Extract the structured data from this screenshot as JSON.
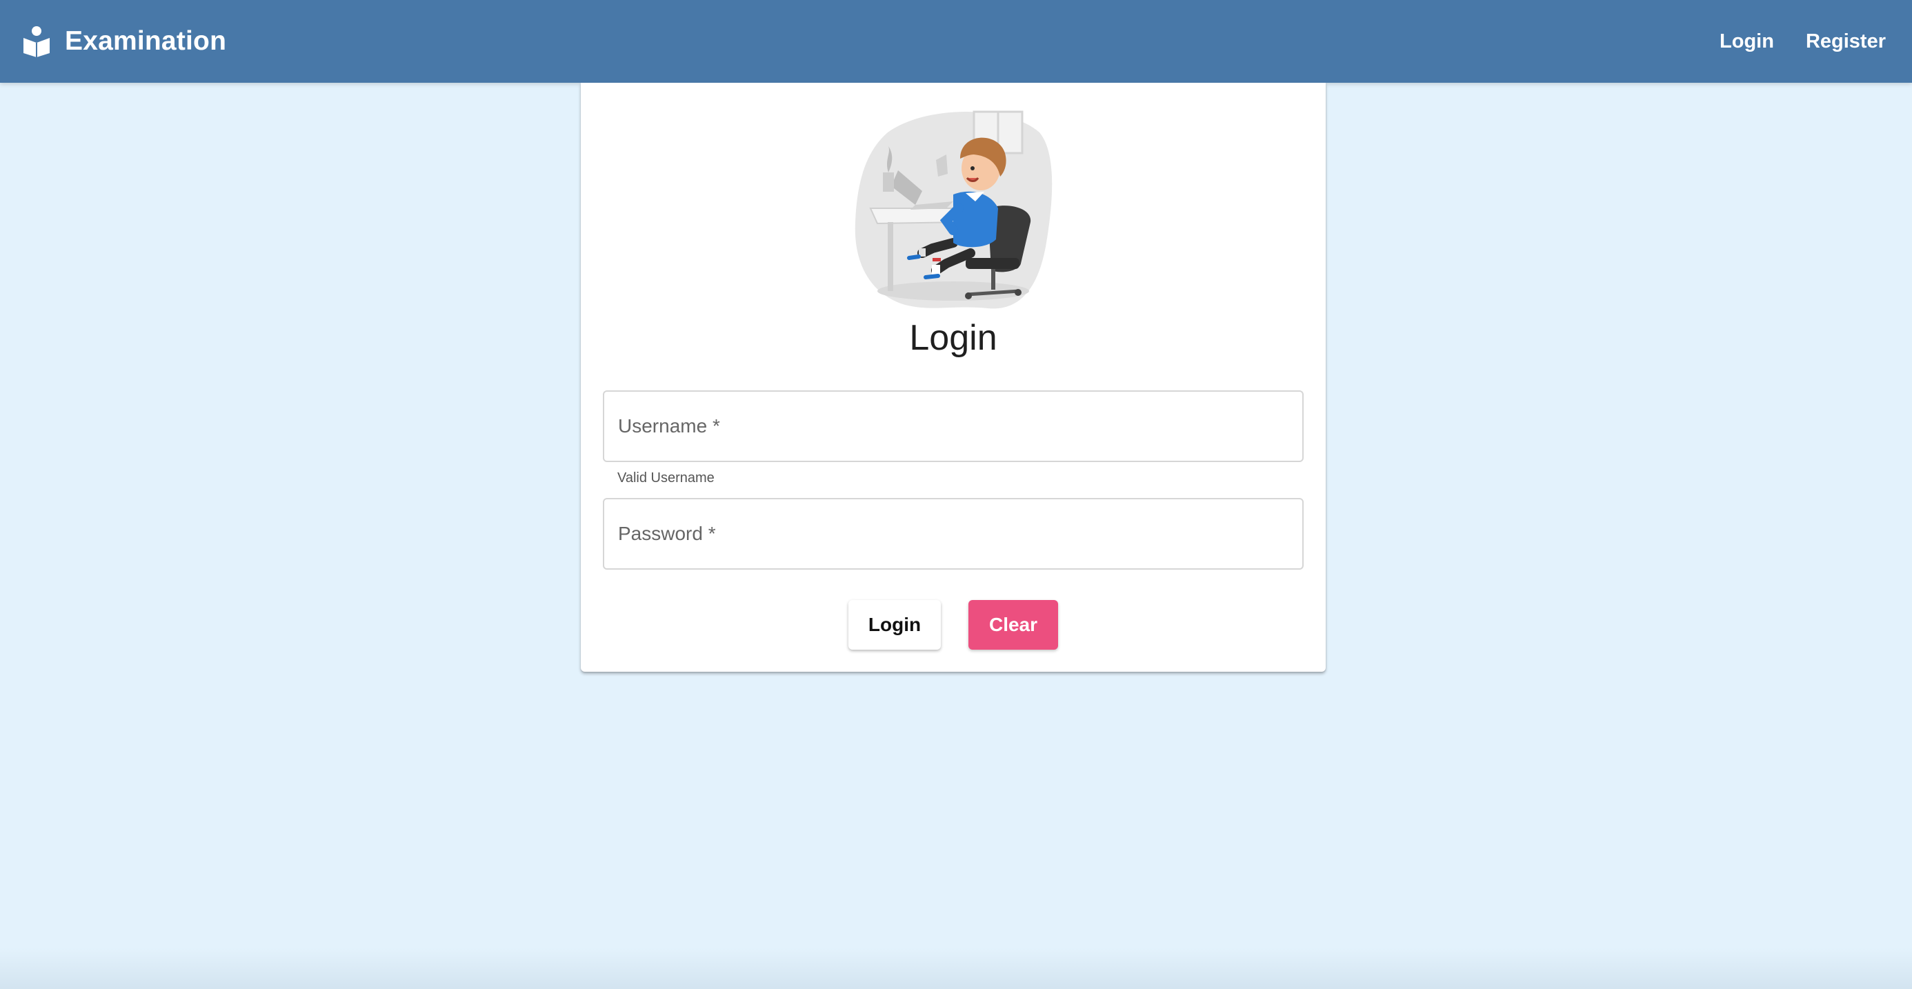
{
  "header": {
    "brand_title": "Examination",
    "brand_icon": "reader-icon",
    "nav": {
      "login_label": "Login",
      "register_label": "Register"
    }
  },
  "card": {
    "illustration": "person-at-desk-illustration",
    "title": "Login",
    "username": {
      "placeholder": "Username *",
      "value": "",
      "helper_text": "Valid Username"
    },
    "password": {
      "placeholder": "Password *",
      "value": ""
    },
    "buttons": {
      "login_label": "Login",
      "clear_label": "Clear"
    }
  },
  "colors": {
    "header": "#4878a8",
    "background": "#e3f2fc",
    "clear_button": "#ec4f7f"
  }
}
